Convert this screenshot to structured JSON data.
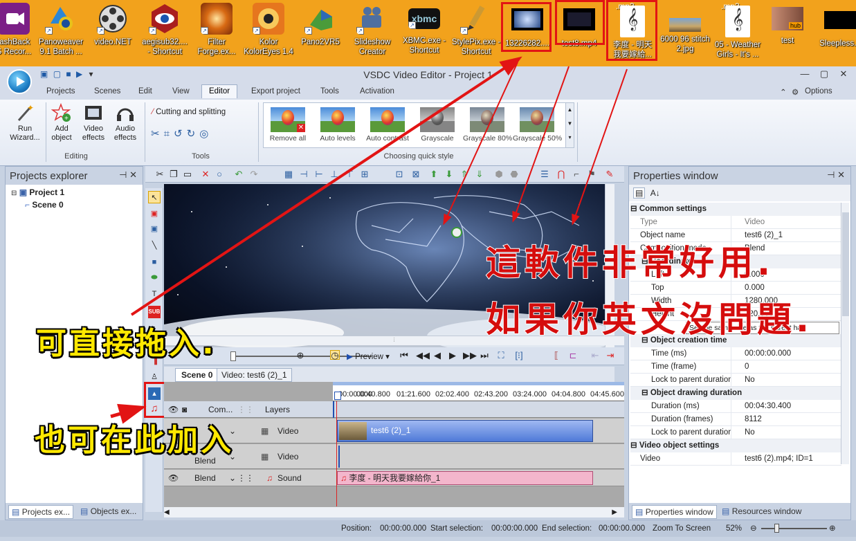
{
  "desktop": {
    "icons": [
      {
        "label": "lashBack\nS Recor...",
        "icon": "flashback-icon"
      },
      {
        "label": "Panoweaver\n9.1 Batch ...",
        "icon": "panoweaver-icon"
      },
      {
        "label": "video.NET",
        "icon": "film-reel-icon"
      },
      {
        "label": "aegisub32....\n- Shortcut",
        "icon": "aegisub-eye-icon"
      },
      {
        "label": "Filter\nForge.ex...",
        "icon": "filter-forge-icon"
      },
      {
        "label": "Kolor\nKolorEyes 1.4",
        "icon": "kolor-eyes-icon"
      },
      {
        "label": "Pano2VR5",
        "icon": "pano2vr-icon"
      },
      {
        "label": "Slideshow\nCreator",
        "icon": "projector-icon"
      },
      {
        "label": "XBMC.exe -\nShortcut",
        "icon": "xbmc-icon"
      },
      {
        "label": "StylePix.exe -\nShortcut",
        "icon": "stylepix-icon"
      },
      {
        "label": "13226282....",
        "icon": "video-thumb-icon"
      },
      {
        "label": "test8.mp4",
        "icon": "video-file-icon"
      },
      {
        "label": "李度 - 明天\n我要嫁給...",
        "icon": "mp3-file-icon"
      },
      {
        "label": "6000 96 stitch\n2.jpg",
        "icon": "panorama-image-icon"
      },
      {
        "label": "05 - Weather\nGirls - It's ...",
        "icon": "mp3-file-icon"
      },
      {
        "label": "test",
        "icon": "hub-image-icon"
      },
      {
        "label": "Sleepless.2",
        "icon": "video-file-icon"
      }
    ],
    "mp3_tag": ".mp3"
  },
  "window": {
    "title": "VSDC Video Editor - Project 1",
    "tabs": [
      "Projects",
      "Scenes",
      "Edit",
      "View",
      "Editor",
      "Export project",
      "Tools",
      "Activation"
    ],
    "active_tab": "Editor",
    "options": "Options"
  },
  "ribbon": {
    "run_wizard": "Run\nWizard...",
    "add_object": "Add\nobject",
    "video_effects": "Video\neffects",
    "audio_effects": "Audio\neffects",
    "editing_group": "Editing",
    "cutting": "Cutting and splitting",
    "tools_group": "Tools",
    "quick_styles": [
      "Remove all",
      "Auto levels",
      "Auto contrast",
      "Grayscale",
      "Grayscale 80%",
      "Grayscale 50%"
    ],
    "quick_style_group": "Choosing quick style"
  },
  "projects": {
    "title": "Projects explorer",
    "project": "Project 1",
    "scene": "Scene 0",
    "bottom_tabs": [
      "Projects ex...",
      "Objects ex..."
    ]
  },
  "preview": {
    "play_label": "Preview",
    "scene_tab": "Scene 0",
    "video_tab": "Video: test6 (2)_1"
  },
  "timeline": {
    "ruler": [
      "00:00.000",
      "00:40.800",
      "01:21.600",
      "02:02.400",
      "02:43.200",
      "03:24.000",
      "04:04.800",
      "04:45.600"
    ],
    "header_com": "Com...",
    "header_layers": "Layers",
    "rows": [
      {
        "blend": "",
        "type": "Video",
        "clip": "test6 (2)_1"
      },
      {
        "blend": "Blend",
        "type": "Video",
        "clip": ""
      },
      {
        "blend": "Blend",
        "type": "Sound",
        "clip": "李度 - 明天我要嫁給你_1"
      }
    ]
  },
  "properties": {
    "title": "Properties window",
    "sections": {
      "common": "Common settings",
      "coords": "Coordinates",
      "creation": "Object creation time",
      "drawing": "Object drawing duration",
      "video_obj": "Video object settings"
    },
    "rows": {
      "type": [
        "Type",
        "Video"
      ],
      "name": [
        "Object name",
        "test6 (2)_1"
      ],
      "comp": [
        "Composition mode",
        "Blend"
      ],
      "left": [
        "Left",
        "0.000"
      ],
      "top": [
        "Top",
        "0.000"
      ],
      "width": [
        "Width",
        "1280.000"
      ],
      "height": [
        "Height",
        "720.000"
      ],
      "tms": [
        "Time (ms)",
        "00:00:00.000"
      ],
      "tframe": [
        "Time (frame)",
        "0"
      ],
      "lock1": [
        "Lock to parent duration",
        "No"
      ],
      "dms": [
        "Duration (ms)",
        "00:04:30.400"
      ],
      "dframes": [
        "Duration (frames)",
        "8112"
      ],
      "lock2": [
        "Lock to parent duration",
        "No"
      ],
      "video": [
        "Video",
        "test6 (2).mp4; ID=1"
      ]
    },
    "tooltip": "Set the same size as the parent has",
    "bottom_tabs": [
      "Properties window",
      "Resources window"
    ]
  },
  "status": {
    "position": "Position:",
    "position_val": "00:00:00.000",
    "start": "Start selection:",
    "start_val": "00:00:00.000",
    "end": "End selection:",
    "end_val": "00:00:00.000",
    "zoom_label": "Zoom To Screen",
    "zoom": "52%"
  },
  "annotations": {
    "red1": "這軟件非常好用.",
    "red2": "如果你英文沒問題.",
    "yellow1": "可直接拖入.",
    "yellow2": "也可在此加入"
  },
  "colors": {
    "accent": "#e21414",
    "desktop": "#f2a21c",
    "annotation_yellow": "#ffe800",
    "annotation_red": "#d50d0d"
  }
}
